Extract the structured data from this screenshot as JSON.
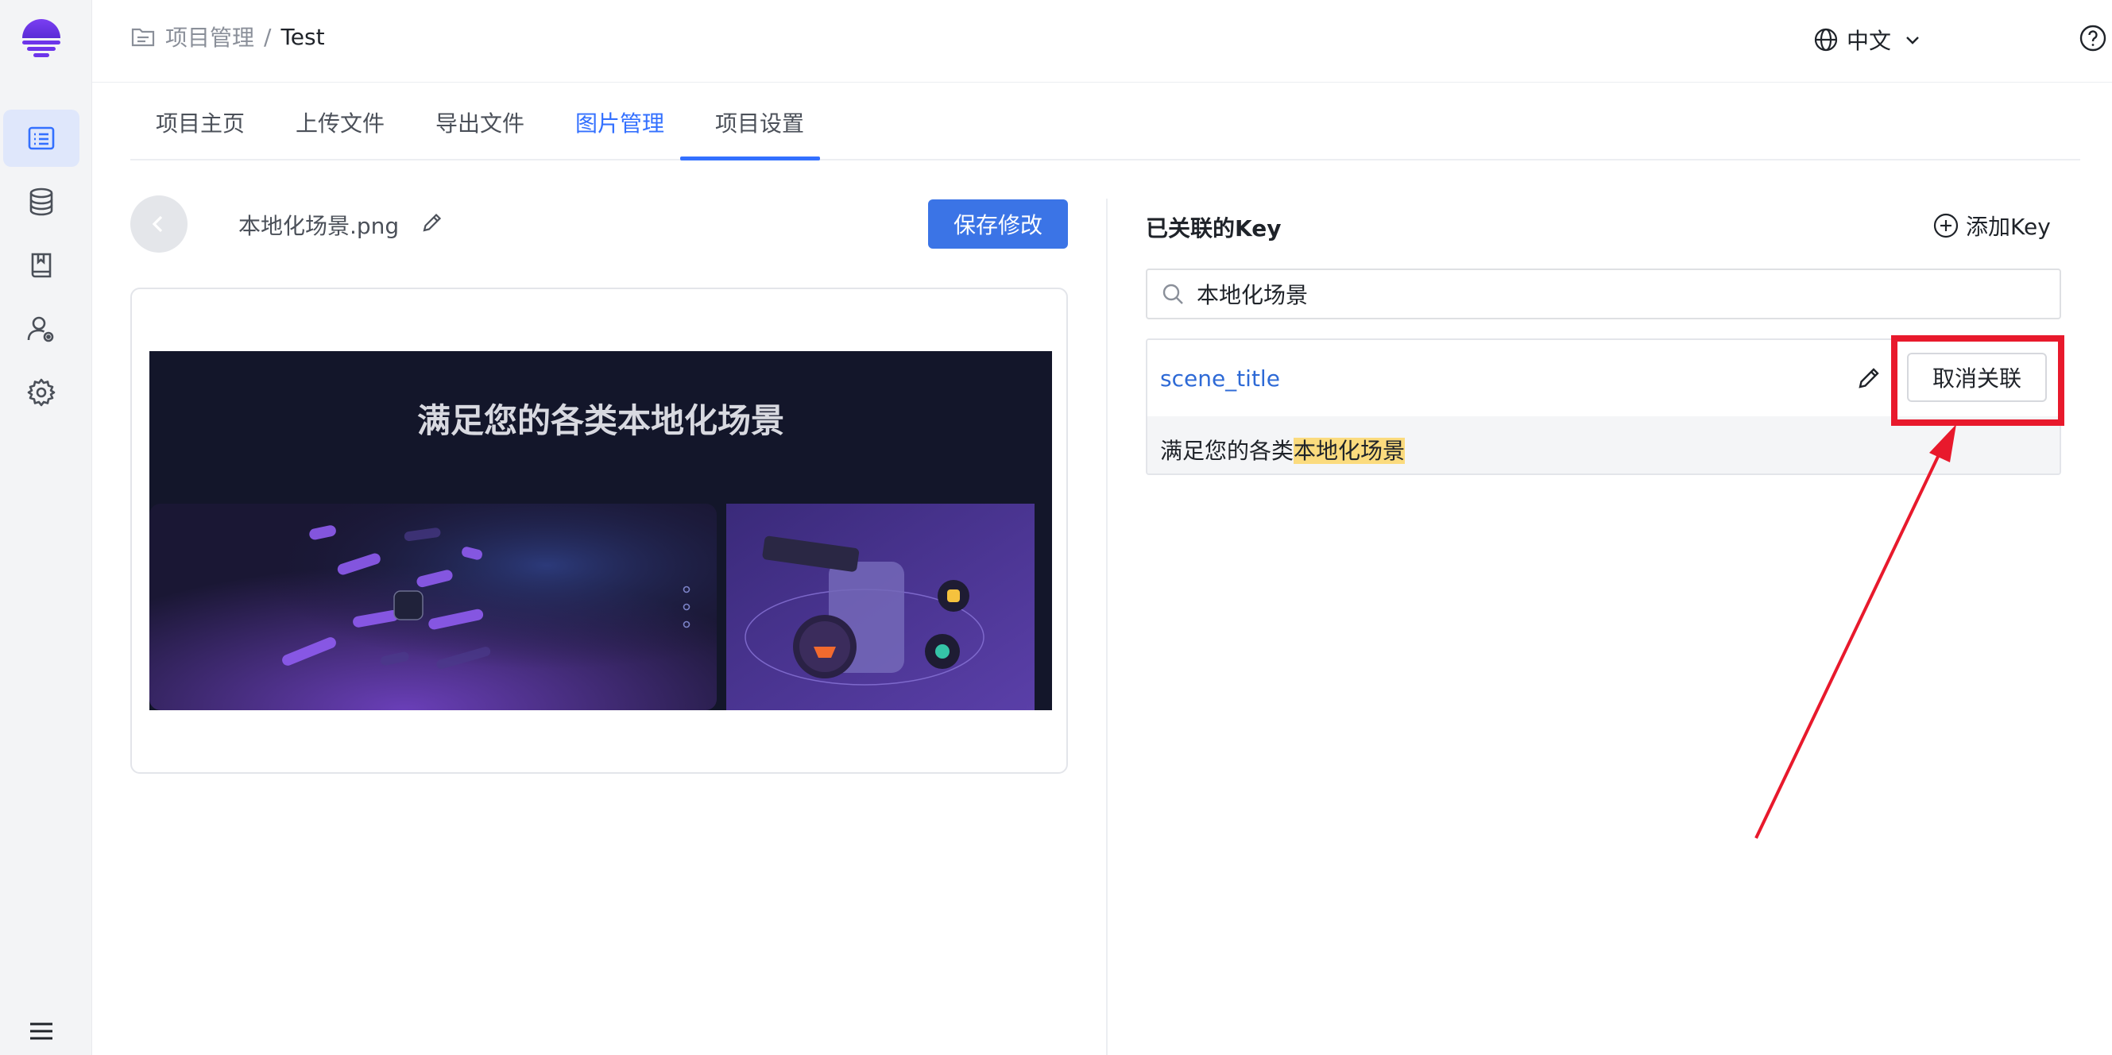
{
  "header": {
    "breadcrumb_root": "项目管理",
    "breadcrumb_sep": "/",
    "breadcrumb_current": "Test",
    "language": "中文"
  },
  "tabs": [
    {
      "label": "项目主页"
    },
    {
      "label": "上传文件"
    },
    {
      "label": "导出文件"
    },
    {
      "label": "图片管理"
    },
    {
      "label": "项目设置"
    }
  ],
  "editor": {
    "filename": "本地化场景.png",
    "save_label": "保存修改",
    "preview_title": "满足您的各类本地化场景"
  },
  "linked": {
    "title": "已关联的Key",
    "add_key_label": "添加Key",
    "search_value": "本地化场景",
    "keys": [
      {
        "name": "scene_title",
        "value_prefix": "满足您的各类",
        "value_highlight": "本地化场景",
        "unlink_label": "取消关联"
      }
    ]
  },
  "colors": {
    "accent": "#3b74e6",
    "annotation_red": "#e8192c",
    "highlight": "#fbdb7e"
  }
}
